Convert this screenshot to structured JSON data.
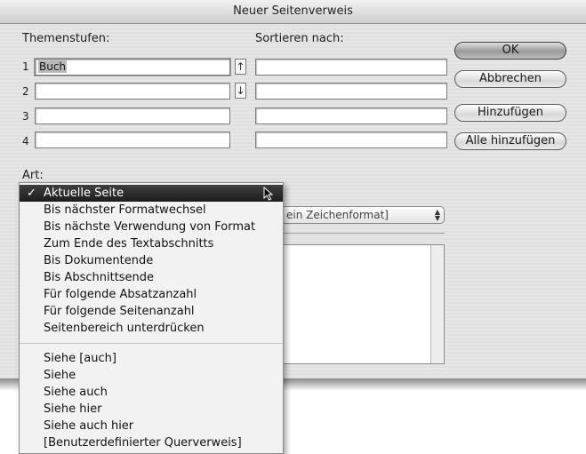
{
  "window": {
    "title": "Neuer Seitenverweis"
  },
  "topics": {
    "label": "Themenstufen:",
    "sort_label": "Sortieren nach:",
    "levels": [
      {
        "number": "1",
        "value": "Buch",
        "sort": ""
      },
      {
        "number": "2",
        "value": "",
        "sort": ""
      },
      {
        "number": "3",
        "value": "",
        "sort": ""
      },
      {
        "number": "4",
        "value": "",
        "sort": ""
      }
    ],
    "up_arrow": "↑",
    "down_arrow": "↓"
  },
  "buttons": {
    "ok": "OK",
    "cancel": "Abbrechen",
    "add": "Hinzufügen",
    "add_all": "Alle hinzufügen"
  },
  "type": {
    "label": "Art:",
    "format_select_value": "ein Zeichenformat]",
    "format_stepper": "▲▼"
  },
  "type_menu": {
    "checkmark": "✓",
    "selected_index": 0,
    "items": [
      "Aktuelle Seite",
      "Bis nächster Formatwechsel",
      "Bis nächste Verwendung von Format",
      "Zum Ende des Textabschnitts",
      "Bis Dokumentende",
      "Bis Abschnittsende",
      "Für folgende Absatzanzahl",
      "Für folgende Seitenanzahl",
      "Seitenbereich unterdrücken"
    ],
    "cross_ref_items": [
      "Siehe [auch]",
      "Siehe",
      "Siehe auch",
      "Siehe hier",
      "Siehe auch hier",
      "[Benutzerdefinierter Querverweis]"
    ]
  }
}
